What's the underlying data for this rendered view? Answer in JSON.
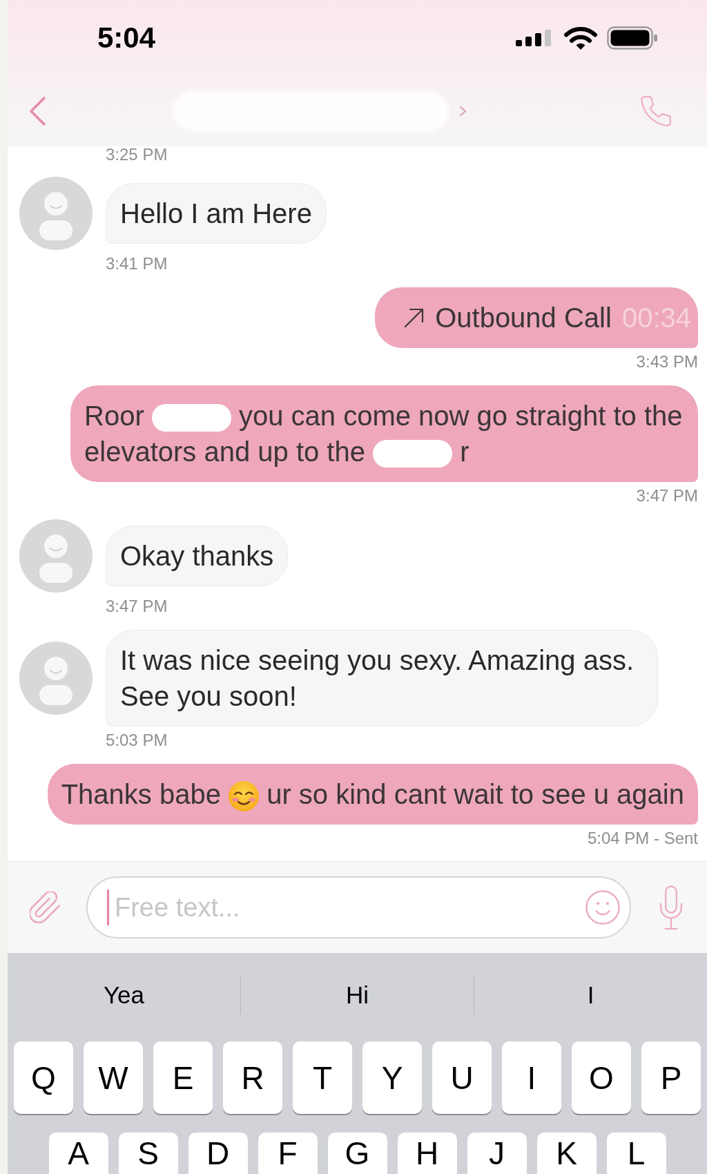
{
  "status_bar": {
    "time": "5:04"
  },
  "nav_bar": {
    "title": {
      "kind": "redaction"
    }
  },
  "chat": {
    "earlier_time": "3:25 PM",
    "messages": [
      {
        "outgoing": false,
        "kind": "text",
        "parts": [
          {
            "kind": "text",
            "text": "Hello I am Here"
          }
        ],
        "time": "3:41 PM"
      },
      {
        "outgoing": true,
        "kind": "call",
        "label": "Outbound Call",
        "duration": "00:34",
        "time": "3:43 PM"
      },
      {
        "outgoing": true,
        "kind": "text",
        "parts": [
          {
            "kind": "text",
            "text": "Roor"
          },
          {
            "kind": "redaction"
          },
          {
            "kind": "text",
            "text": "you can come now go straight to the"
          },
          {
            "kind": "text",
            "text": "elevators and up to the"
          },
          {
            "kind": "redaction"
          },
          {
            "kind": "text",
            "text": "r"
          }
        ],
        "time": "3:47 PM"
      },
      {
        "outgoing": false,
        "kind": "text",
        "parts": [
          {
            "kind": "text",
            "text": "Okay thanks"
          }
        ],
        "time": "3:47 PM"
      },
      {
        "outgoing": false,
        "kind": "text",
        "parts": [
          {
            "kind": "text",
            "text": "It was nice seeing you sexy. Amazing ass. See you soon!"
          }
        ],
        "time": "5:03 PM"
      },
      {
        "outgoing": true,
        "kind": "text",
        "parts": [
          {
            "kind": "text",
            "text": "Thanks babe"
          },
          {
            "kind": "emoji"
          },
          {
            "kind": "text",
            "text": "ur so kind cant wait to see u again"
          }
        ],
        "time": "5:04 PM - Sent"
      }
    ]
  },
  "composer": {
    "placeholder": "Free text...",
    "focused": true
  },
  "keyboard": {
    "suggestions": [
      "Yea",
      "Hi",
      "I"
    ],
    "rows": [
      [
        "Q",
        "W",
        "E",
        "R",
        "T",
        "Y",
        "U",
        "I",
        "O",
        "P"
      ],
      [
        "A",
        "S",
        "D",
        "F",
        "G",
        "H",
        "J",
        "K",
        "L"
      ]
    ]
  }
}
